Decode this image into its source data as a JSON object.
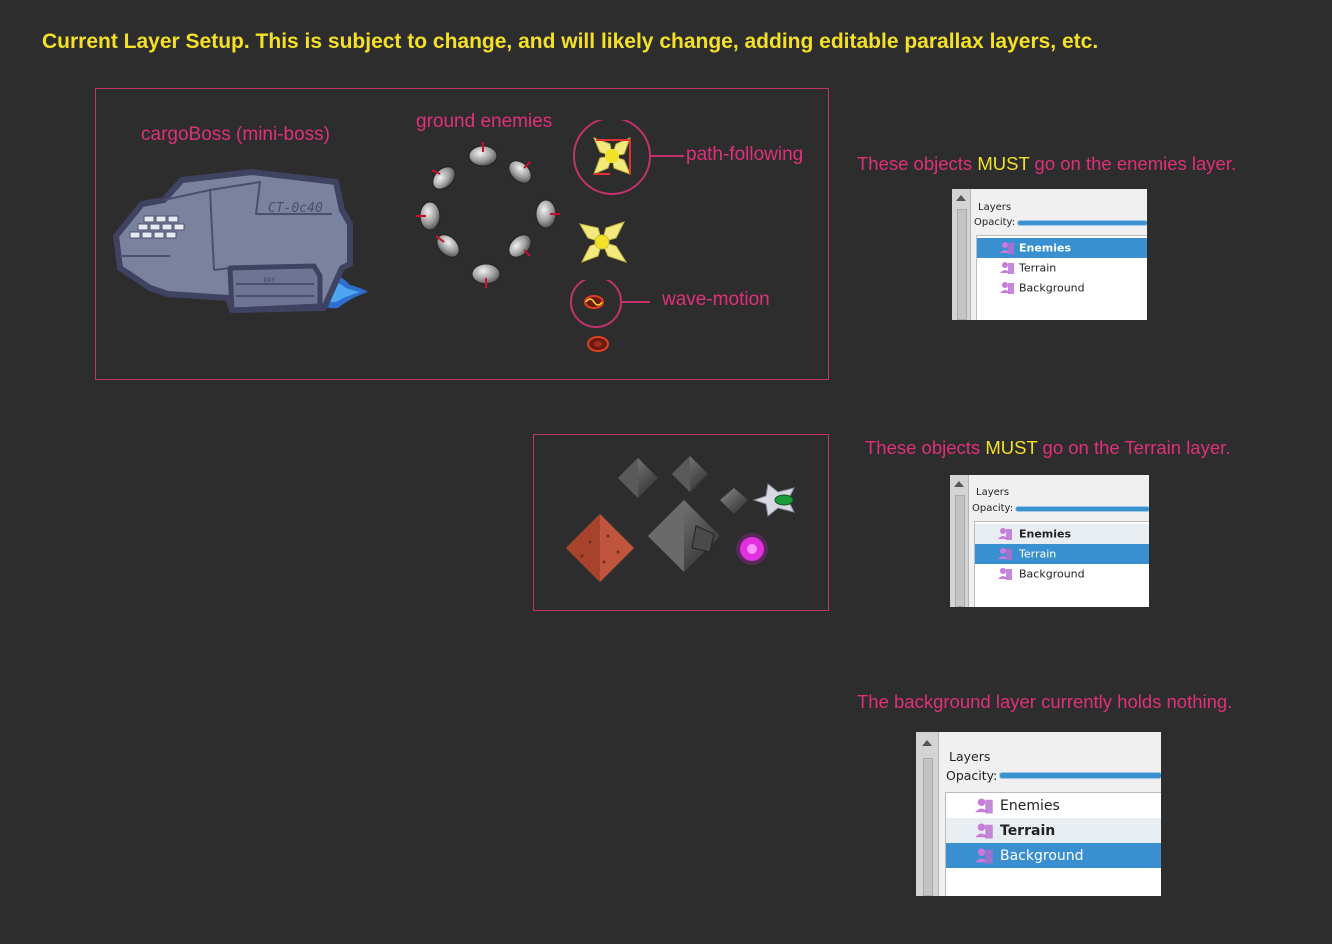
{
  "title": "Current Layer Setup.  This is subject to change, and will likely change, adding editable parallax layers, etc.",
  "enemies_box": {
    "cargo_label": "cargoBoss (mini-boss)",
    "ground_label": "ground enemies",
    "path_label": "path-following",
    "wave_label": "wave-motion",
    "ship_hull_text": "CT-0c40",
    "ship_thruster_text": "DAY"
  },
  "notes": {
    "enemies_prefix": "These objects ",
    "enemies_must": "MUST",
    "enemies_suffix": " go on the enemies layer.",
    "terrain_prefix": "These objects ",
    "terrain_must": "MUST",
    "terrain_suffix": " go on the Terrain layer.",
    "background": "The background layer currently holds nothing."
  },
  "panels": [
    {
      "header": "Layers",
      "opacity_label": "Opacity:",
      "layers": [
        "Enemies",
        "Terrain",
        "Background"
      ],
      "selected": "Enemies"
    },
    {
      "header": "Layers",
      "opacity_label": "Opacity:",
      "layers": [
        "Enemies",
        "Terrain",
        "Background"
      ],
      "selected": "Terrain"
    },
    {
      "header": "Layers",
      "opacity_label": "Opacity:",
      "layers": [
        "Enemies",
        "Terrain",
        "Background"
      ],
      "selected": "Background"
    }
  ],
  "colors": {
    "background": "#2d2d2d",
    "title_yellow": "#f4e026",
    "accent_pink": "#e0307a",
    "frame_pink": "#c2326d",
    "selection_blue": "#3a8fd0",
    "layer_icon": "#c97adb"
  },
  "icons": [
    "layer-icon",
    "scroll-up-arrow-icon"
  ]
}
